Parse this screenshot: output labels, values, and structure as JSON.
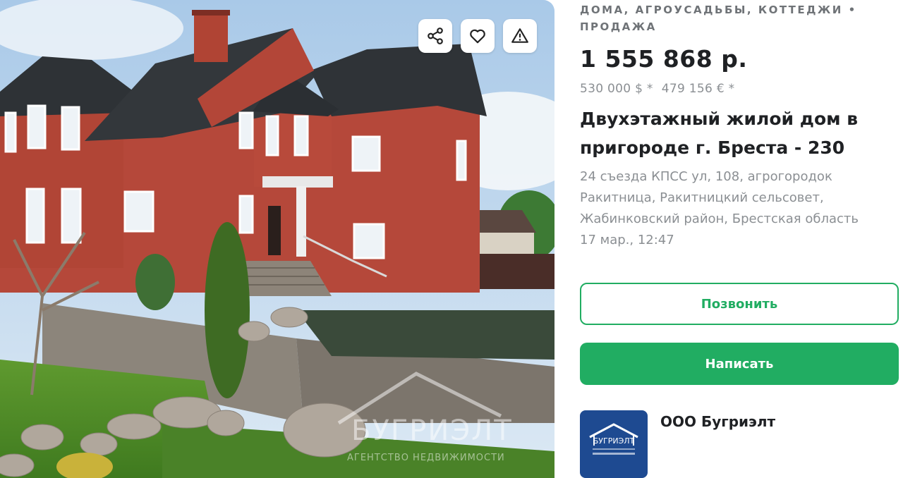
{
  "listing": {
    "category": "ДОМА, АГРОУСАДЬБЫ, КОТТЕДЖИ • ПРОДАЖА",
    "price_byn": "1 555 868 р.",
    "price_usd": "530 000 $ *",
    "price_eur": "479 156 € *",
    "title": "Двухэтажный жилой дом в пригороде г. Бреста - 230",
    "address_line1": "24 съезда КПСС ул, 108, агрогородок",
    "address_line2": "Ракитница, Ракитницкий сельсовет,",
    "address_line3": "Жабинковский район, Брестская область",
    "date": "17 мар., 12:47"
  },
  "actions": {
    "call_label": "Позвонить",
    "write_label": "Написать"
  },
  "photo": {
    "icons": [
      "share-icon",
      "heart-icon",
      "warning-icon"
    ],
    "watermark_name": "БУГРИЭЛТ",
    "watermark_sub": "АГЕНТСТВО НЕДВИЖИМОСТИ"
  },
  "seller": {
    "name": "ООО Бугриэлт",
    "logo_text": "БУГРИЭЛТ"
  },
  "colors": {
    "accent_green": "#21ad62",
    "text_dark": "#1f2124",
    "text_muted": "#8b8f93",
    "logo_blue": "#1e4a91"
  }
}
